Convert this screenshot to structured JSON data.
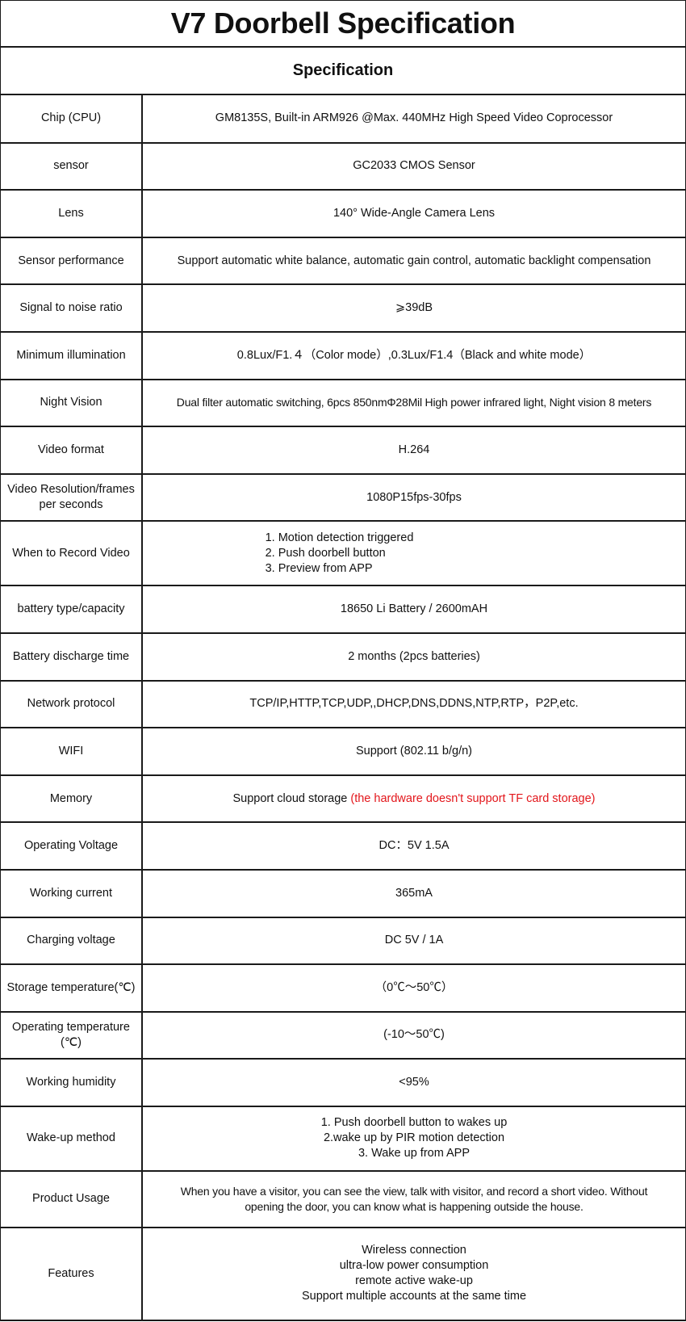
{
  "title": "V7 Doorbell Specification",
  "subheader": "Specification",
  "rows": {
    "chip": {
      "label": "Chip (CPU)",
      "value": "GM8135S, Built-in ARM926 @Max. 440MHz High Speed Video Coprocessor"
    },
    "sensor": {
      "label": "sensor",
      "value": "GC2033 CMOS Sensor"
    },
    "lens": {
      "label": "Lens",
      "value": "140° Wide-Angle Camera Lens"
    },
    "sensor_performance": {
      "label": "Sensor performance",
      "value": "Support automatic white balance, automatic gain control, automatic backlight compensation"
    },
    "snr": {
      "label": "Signal to noise ratio",
      "value": "⩾39dB"
    },
    "min_illumination": {
      "label": "Minimum illumination",
      "value": "0.8Lux/F1.４（Color mode）,0.3Lux/F1.4（Black and white mode）"
    },
    "night_vision": {
      "label": "Night Vision",
      "value": "Dual filter automatic switching, 6pcs 850nmΦ28Mil High power infrared light, Night vision 8 meters"
    },
    "video_format": {
      "label": "Video format",
      "value": "H.264"
    },
    "video_resolution": {
      "label": "Video Resolution/frames per seconds",
      "value": "1080P15fps-30fps"
    },
    "record_video": {
      "label": "When to Record Video",
      "lines": [
        "1. Motion detection triggered",
        "2. Push doorbell button",
        "3. Preview from APP"
      ]
    },
    "battery_type": {
      "label": "battery type/capacity",
      "value": "18650 Li Battery / 2600mAH"
    },
    "battery_discharge": {
      "label": "Battery discharge time",
      "value": "2 months (2pcs batteries)"
    },
    "network_protocol": {
      "label": "Network protocol",
      "value": "TCP/IP,HTTP,TCP,UDP,,DHCP,DNS,DDNS,NTP,RTP，P2P,etc."
    },
    "wifi": {
      "label": "WIFI",
      "value": "Support (802.11 b/g/n)"
    },
    "memory": {
      "label": "Memory",
      "value": "Support cloud storage ",
      "note": "(the hardware doesn't support TF card storage)",
      "note_color": "#e3161b"
    },
    "operating_voltage": {
      "label": "Operating Voltage",
      "value": "DC：5V 1.5A"
    },
    "working_current": {
      "label": "Working current",
      "value": "365mA"
    },
    "charging_voltage": {
      "label": "Charging voltage",
      "value": "DC 5V / 1A"
    },
    "storage_temp": {
      "label": "Storage temperature(℃)",
      "value": "（0℃～50℃）"
    },
    "operating_temp": {
      "label": "Operating temperature (℃)",
      "value": "(-10～50℃)"
    },
    "humidity": {
      "label": "Working humidity",
      "value": "<95%"
    },
    "wakeup": {
      "label": "Wake-up method",
      "lines": [
        "1. Push doorbell button to wakes up",
        "2.wake up by PIR motion detection",
        "3. Wake up from APP"
      ]
    },
    "usage": {
      "label": "Product Usage",
      "lines": [
        "When you have a visitor, you can see the view, talk with visitor, and record a short video. Without",
        "opening the door, you can know what is happening outside the house."
      ]
    },
    "features": {
      "label": "Features",
      "lines": [
        "Wireless connection",
        "ultra-low power consumption",
        "remote active wake-up",
        "Support multiple accounts at the same time"
      ]
    }
  }
}
